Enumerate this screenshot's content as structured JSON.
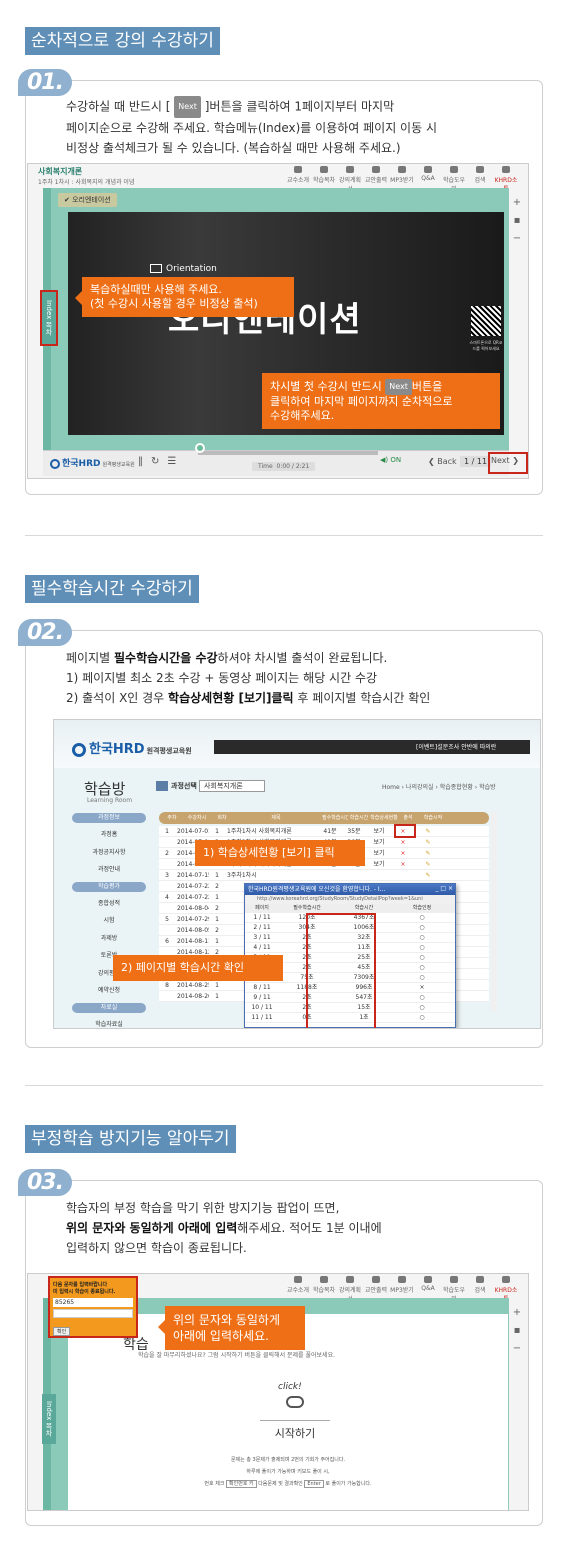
{
  "sections": [
    {
      "title": "순차적으로 강의 수강하기",
      "badge": "01.",
      "lines": [
        "수강하실 때 반드시 [",
        "]버튼을 클릭하여 1페이지부터 마지막",
        "페이지순으로 수강해 주세요. 학습메뉴(Index)를 이용하여 페이지 이동 시",
        "비정상 출석체크가 될 수 있습니다. (복습하실 때만 사용해 주세요.)"
      ],
      "next_label": "Next",
      "course_title": "사회복지개론",
      "course_sub": "1주차 1차시 : 사회복지의 개념과 이념",
      "toolbar": [
        "교수소개",
        "학습목차",
        "강의계획서",
        "교안출력",
        "MP3받기",
        "Q&A",
        "학습도우미",
        "검색",
        "KHRD소통"
      ],
      "review_tab": "✔ 오리엔테이션",
      "orientation_small": "Orientation",
      "orientation_big": "오리엔테이션",
      "index_label": "Index 목차",
      "callout1": [
        "복습하실때만 사용해 주세요.",
        "(첫 수강시 사용할 경우 비정상 출석)"
      ],
      "callout2_a": "차시별 첫 수강시 반드시",
      "callout2_b": "버튼을",
      "callout2_lines": [
        "클릭하여 마지막 페이지까지 순차적으로",
        "수강해주세요."
      ],
      "qr_text": "스마트폰으로 QR코드를 찍어보세요",
      "logo": "한국HRD",
      "logo_sub": "원격평생교육원",
      "time_label": "Time",
      "time_value": "0:00 / 2:21",
      "on": "ON",
      "back": "Back",
      "page": "1 / 11"
    },
    {
      "title": "필수학습시간 수강하기",
      "badge": "02.",
      "lines": [
        "페이지별 ",
        "필수학습시간을 수강",
        "하셔야 차시별 출석이 완료됩니다.",
        "1) 페이지별 최소 2초 수강 + 동영상 페이지는 해당 시간 수강",
        "2) 출석이 X인 경우 ",
        "학습상세현황 [보기]클릭",
        " 후 페이지별 학습시간 확인"
      ],
      "logo": "한국HRD",
      "logo_sub": "원격평생교육원",
      "greeting": "[이벤트]설문조사 안반에 따의란",
      "room_title": "학습방",
      "room_sub": "Learning Room",
      "menu": [
        "과정정보",
        "과정홈",
        "과정공지사항",
        "과정안내",
        "학습평가",
        "종합성적",
        "시험",
        "과제방",
        "토론방",
        "강의평가",
        "예약신청",
        "자료실",
        "학습자료실",
        "수강생끼리 나누기(Q&A)",
        "교수님께 질문하기"
      ],
      "course_select": "과정선택",
      "course_name": "사회복지개론",
      "breadcrumb": "Home › 나의강의실 › 학습종합현황 › 학습방",
      "headers": [
        "주차",
        "수강차시",
        "회차",
        "제목",
        "필수학습시간",
        "학습시간",
        "학습상세현황",
        "출석",
        "학습시작"
      ],
      "rows": [
        [
          "1",
          "2014-07-01",
          "1",
          "1주차1차시 사회복지개론",
          "41분",
          "35분",
          "보기",
          "×"
        ],
        [
          "",
          "2014-07-08",
          "2",
          "1주차2차시 사회복지개론",
          "41분",
          "36분",
          "보기",
          "×"
        ],
        [
          "2",
          "2014-07-08",
          "1",
          "2주차1차시 사회복지개론",
          "41분",
          "28분",
          "보기",
          "×"
        ],
        [
          "",
          "2014-07-15",
          "2",
          "2주차2차시 사회복지개론",
          "41분",
          "28분",
          "보기",
          "×"
        ],
        [
          "3",
          "2014-07-15",
          "1",
          "3주차1차시",
          "",
          "",
          "",
          ""
        ],
        [
          "",
          "2014-07-22",
          "2",
          "",
          "",
          "",
          "",
          ""
        ],
        [
          "4",
          "2014-07-22",
          "1",
          "",
          "",
          "",
          "",
          ""
        ],
        [
          "",
          "2014-08-04",
          "2",
          "",
          "",
          "",
          "",
          ""
        ],
        [
          "5",
          "2014-07-29",
          "1",
          "",
          "",
          "",
          "",
          ""
        ],
        [
          "",
          "2014-08-05",
          "2",
          "",
          "",
          "",
          "",
          ""
        ],
        [
          "6",
          "2014-08-11",
          "1",
          "",
          "",
          "",
          "",
          ""
        ],
        [
          "",
          "2014-08-12",
          "2",
          "",
          "",
          "",
          "",
          ""
        ],
        [
          "7",
          "2014-08-21",
          "1",
          "",
          "",
          "",
          "",
          ""
        ],
        [
          "",
          "2014-08-22",
          "2",
          "",
          "",
          "",
          "",
          ""
        ],
        [
          "8",
          "2014-08-25",
          "1",
          "",
          "",
          "",
          "",
          ""
        ],
        [
          "",
          "2014-08-26",
          "1",
          "",
          "",
          "",
          "",
          ""
        ]
      ],
      "popup_title": "한국HRD원격평생교육원에 오신것을 환영합니다. - I...",
      "popup_url": "http://www.koreahrd.org/StudyRoom/StudyDetailPop?week=1&uni",
      "popup_headers": [
        "페이지",
        "필수학습시간",
        "학습시간",
        "학습인정"
      ],
      "popup_rows": [
        [
          "1 / 11",
          "120초",
          "4367초",
          "○"
        ],
        [
          "2 / 11",
          "304초",
          "1006초",
          "○"
        ],
        [
          "3 / 11",
          "2초",
          "32초",
          "○"
        ],
        [
          "4 / 11",
          "2초",
          "11초",
          "○"
        ],
        [
          "5 / 11",
          "2초",
          "25초",
          "○"
        ],
        [
          "6 / 11",
          "2초",
          "45초",
          "○"
        ],
        [
          "7 / 11",
          "75초",
          "7309초",
          "○"
        ],
        [
          "8 / 11",
          "1188초",
          "996초",
          "×"
        ],
        [
          "9 / 11",
          "2초",
          "547초",
          "○"
        ],
        [
          "10 / 11",
          "2초",
          "15초",
          "○"
        ],
        [
          "11 / 11",
          "0초",
          "1초",
          "○"
        ]
      ],
      "callout1": "1) 학습상세현황 [보기] 클릭",
      "callout2": "2) 페이지별 학습시간 확인"
    },
    {
      "title": "부정학습 방지기능 알아두기",
      "badge": "03.",
      "lines": [
        "학습자의 부정 학습을 막기 위한 방지기능 팝업이 뜨면,",
        "위의 문자와 동일하게 아래에 입력",
        "해주세요. 적어도 1분 이내에",
        "입력하지 않으면 학습이 종료됩니다."
      ],
      "popup_title": "다음 문자를 입력바랍니다",
      "popup_sub": "미 입력시 학습이 종료됩니다.",
      "popup_code": "85265",
      "popup_btn": "확인",
      "callout": [
        "위의 문자와 동일하게",
        "아래에 입력하세요."
      ],
      "toolbar": [
        "교수소개",
        "학습목차",
        "강의계획서",
        "교안출력",
        "MP3받기",
        "Q&A",
        "학습도우미",
        "검색",
        "KHRD소통"
      ],
      "index_label": "Index 목차",
      "learn_title": "학습",
      "learn_sub": "학습을 잘 마무리하셨나요? 그럼 시작하기 버튼을 클릭해서 문제를 풀어보세요.",
      "click": "click!",
      "start": "시작하기",
      "foot1": "문제는 총 3문제가 출제되며 2번의 기회가 주어집니다.",
      "foot2": "하루에 풀이가 가능하며 키보드 풀이 시,",
      "foot3a": "번호 체크",
      "foot3b": "확인번호 키",
      "foot3c": "다음문제 및 결과확인",
      "foot3d": "Enter",
      "foot3e": "로 풀이가 가능합니다."
    }
  ]
}
